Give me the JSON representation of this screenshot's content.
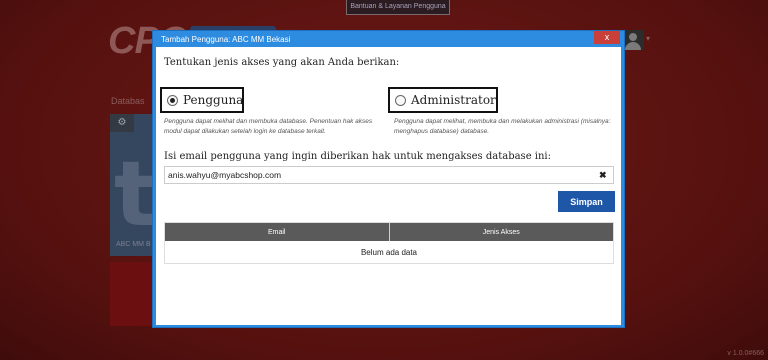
{
  "background": {
    "help_tab": "Bantuan & Layanan Pengguna",
    "logo_text": "CPO",
    "section_label": "Databas",
    "card_letter": "t",
    "card_label": "ABC MM B",
    "gear_icon": "gear-icon",
    "version": "v 1.0.0#666"
  },
  "dialog": {
    "title": "Tambah Pengguna: ABC MM Bekasi",
    "close_label": "x",
    "prompt": "Tentukan jenis akses yang akan Anda berikan:",
    "roles": {
      "user": {
        "label": "Pengguna",
        "description": "Pengguna dapat melihat dan membuka database. Penentuan hak akses modul dapat dilakukan setelah login ke database terkait.",
        "selected": true
      },
      "admin": {
        "label": "Administrator",
        "description": "Pengguna dapat melihat, membuka dan melakukan administrasi (misalnya: menghapus database) database.",
        "selected": false
      }
    },
    "email_prompt": "Isi email pengguna yang ingin diberikan hak untuk mengakses database ini:",
    "email_value": "anis.wahyu@myabcshop.com",
    "clear_label": "✖",
    "save_label": "Simpan",
    "table": {
      "columns": [
        "Email",
        "Jenis Akses"
      ],
      "empty_text": "Belum ada data"
    }
  },
  "colors": {
    "dialog_border": "#2d8be0",
    "save_button": "#1f57a8",
    "close_button": "#c9403a",
    "backdrop": "#5a1412"
  }
}
